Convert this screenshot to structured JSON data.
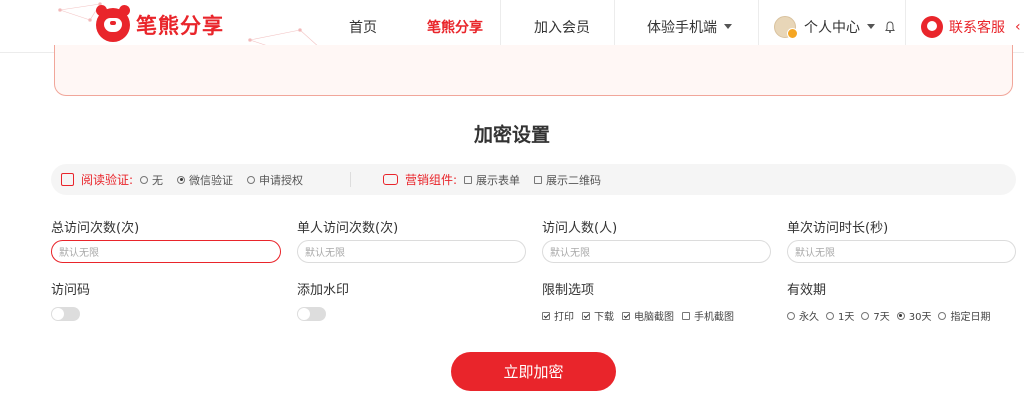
{
  "brand": {
    "logo_text": "笔熊分享"
  },
  "nav": {
    "home": "首页",
    "bear_share": "笔熊分享",
    "join_member": "加入会员",
    "mobile": "体验手机端",
    "personal_center": "个人中心",
    "service": "联系客服"
  },
  "section_title": "加密设置",
  "read_verify": {
    "label": "阅读验证:",
    "options": [
      {
        "label": "无",
        "selected": false
      },
      {
        "label": "微信验证",
        "selected": true
      },
      {
        "label": "申请授权",
        "selected": false
      }
    ]
  },
  "marketing": {
    "label": "营销组件:",
    "options": [
      {
        "label": "展示表单",
        "checked": false
      },
      {
        "label": "展示二维码",
        "checked": false
      }
    ]
  },
  "fields": {
    "total_visits": {
      "label": "总访问次数(次)",
      "placeholder": "默认无限"
    },
    "single_visits": {
      "label": "单人访问次数(次)",
      "placeholder": "默认无限"
    },
    "visitors": {
      "label": "访问人数(人)",
      "placeholder": "默认无限"
    },
    "duration": {
      "label": "单次访问时长(秒)",
      "placeholder": "默认无限"
    },
    "access_code": {
      "label": "访问码",
      "enabled": false
    },
    "watermark": {
      "label": "添加水印",
      "enabled": false
    },
    "restrictions": {
      "label": "限制选项",
      "options": [
        {
          "label": "打印",
          "checked": true
        },
        {
          "label": "下载",
          "checked": true
        },
        {
          "label": "电脑截图",
          "checked": true
        },
        {
          "label": "手机截图",
          "checked": false
        }
      ]
    },
    "validity": {
      "label": "有效期",
      "options": [
        {
          "label": "永久",
          "selected": false
        },
        {
          "label": "1天",
          "selected": false
        },
        {
          "label": "7天",
          "selected": false
        },
        {
          "label": "30天",
          "selected": true
        },
        {
          "label": "指定日期",
          "selected": false
        }
      ]
    }
  },
  "submit_label": "立即加密",
  "colors": {
    "accent": "#e9252b",
    "border_light": "#f1a69a"
  }
}
